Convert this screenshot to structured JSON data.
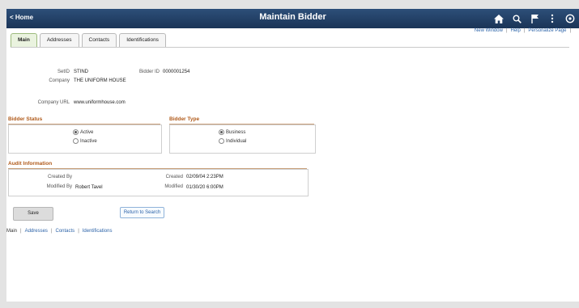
{
  "banner": {
    "home_label": "< Home",
    "title": "Maintain Bidder",
    "icons": [
      "home-icon",
      "search-icon",
      "flag-icon",
      "more-icon",
      "navbar-icon"
    ]
  },
  "tabs": [
    {
      "label": "Main",
      "active": true
    },
    {
      "label": "Addresses",
      "active": false
    },
    {
      "label": "Contacts",
      "active": false
    },
    {
      "label": "Identifications",
      "active": false
    }
  ],
  "toplinks": {
    "new_window": "New Window",
    "help": "Help",
    "personalize": "Personalize Page",
    "sep": "|"
  },
  "fields": {
    "setid_label": "SetID",
    "setid_value": "STIND",
    "bidder_id_label": "Bidder ID",
    "bidder_id_value": "0000001254",
    "company_label": "Company",
    "company_value": "THE UNIFORM HOUSE",
    "url_label": "Company URL",
    "url_value": "www.uniformhouse.com"
  },
  "bidder_status": {
    "title": "Bidder Status",
    "options": [
      "Active",
      "Inactive"
    ],
    "selected": "Active"
  },
  "bidder_type": {
    "title": "Bidder Type",
    "options": [
      "Business",
      "Individual"
    ],
    "selected": "Business"
  },
  "audit": {
    "title": "Audit Information",
    "created_by_label": "Created By",
    "created_by_value": "",
    "modified_by_label": "Modified By",
    "modified_by_value": "Robert Tavel",
    "created_label": "Created",
    "created_value": "02/09/04  2:23PM",
    "modified_label": "Modified",
    "modified_value": "01/30/20  6:00PM"
  },
  "buttons": {
    "save": "Save",
    "return": "Return to Search"
  },
  "bottomlinks": {
    "main": "Main",
    "addresses": "Addresses",
    "contacts": "Contacts",
    "identifications": "Identifications",
    "sep": "|"
  },
  "colors": {
    "banner": "#1f3c63",
    "section_title": "#b05a1a",
    "link": "#2c63a8",
    "active_tab": "#eaf3df"
  }
}
